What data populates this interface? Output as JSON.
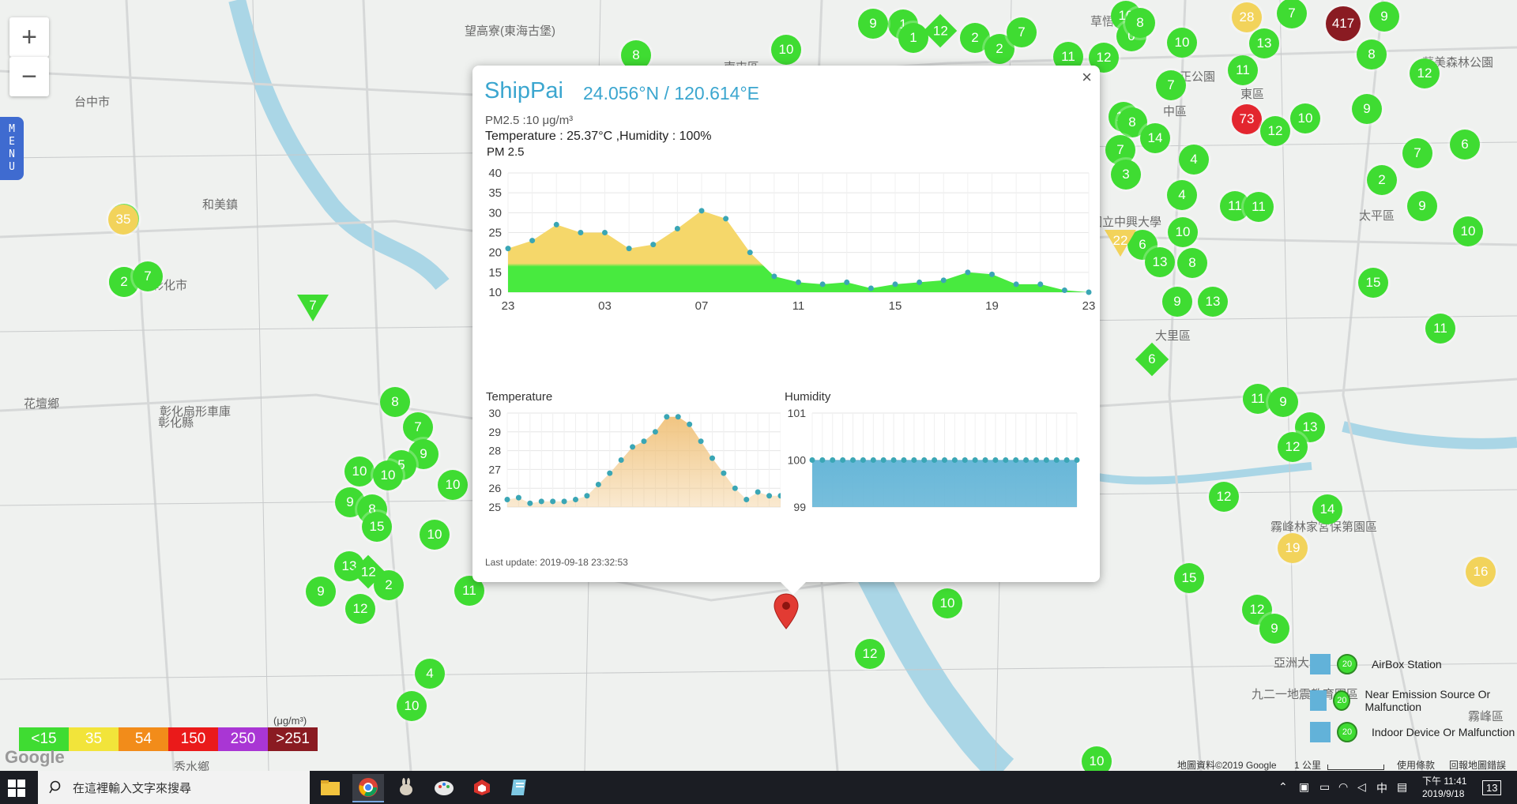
{
  "map": {
    "zoom_in": "+",
    "zoom_out": "−",
    "menu_letters": [
      "M",
      "E",
      "N",
      "U"
    ],
    "places": [
      {
        "name": "望高寮(東海古堡)"
      },
      {
        "name": "和美鎮"
      },
      {
        "name": "彰化市"
      },
      {
        "name": "中區"
      },
      {
        "name": "東區"
      },
      {
        "name": "大里區"
      },
      {
        "name": "太平區"
      },
      {
        "name": "霧峰林家宮保第園區"
      },
      {
        "name": "亞洲大學"
      },
      {
        "name": "九二一地震教育園區"
      },
      {
        "name": "霧峰區"
      },
      {
        "name": "秀水鄉"
      },
      {
        "name": "彰化縣"
      },
      {
        "name": "台中市"
      },
      {
        "name": "南屯區"
      },
      {
        "name": "國立中興大學"
      },
      {
        "name": "草悟道"
      },
      {
        "name": "中正公園"
      },
      {
        "name": "彰化扇形車庫"
      },
      {
        "name": "花壇鄉"
      },
      {
        "name": "華美森林公園"
      }
    ],
    "markers": [
      {
        "v": "8",
        "c": "g"
      },
      {
        "v": "10",
        "c": "g"
      },
      {
        "v": "1",
        "c": "g"
      },
      {
        "v": "9",
        "c": "g"
      },
      {
        "v": "1",
        "c": "g"
      },
      {
        "v": "10",
        "c": "g"
      },
      {
        "v": "0",
        "c": "g"
      },
      {
        "v": "10",
        "c": "g"
      },
      {
        "v": "28",
        "c": "y"
      },
      {
        "v": "7",
        "c": "g"
      },
      {
        "v": "417",
        "c": "m"
      },
      {
        "v": "9",
        "c": "g"
      },
      {
        "v": "2",
        "c": "g"
      },
      {
        "v": "2",
        "c": "g"
      },
      {
        "v": "7",
        "c": "g"
      },
      {
        "v": "11",
        "c": "g"
      },
      {
        "v": "12",
        "c": "g"
      },
      {
        "v": "10",
        "c": "g"
      },
      {
        "v": "13",
        "c": "g"
      },
      {
        "v": "12",
        "c": "g"
      },
      {
        "v": "8",
        "c": "g"
      },
      {
        "v": "11",
        "c": "g"
      },
      {
        "v": "7",
        "c": "g"
      },
      {
        "v": "9",
        "c": "g"
      },
      {
        "v": "73",
        "c": "r"
      },
      {
        "v": "12",
        "c": "g"
      },
      {
        "v": "10",
        "c": "g"
      },
      {
        "v": "8",
        "c": "g"
      },
      {
        "v": "14",
        "c": "g"
      },
      {
        "v": "7",
        "c": "g"
      },
      {
        "v": "6",
        "c": "g"
      },
      {
        "v": "7",
        "c": "g"
      },
      {
        "v": "4",
        "c": "g"
      },
      {
        "v": "3",
        "c": "g"
      },
      {
        "v": "4",
        "c": "g"
      },
      {
        "v": "2",
        "c": "g"
      },
      {
        "v": "9",
        "c": "g"
      },
      {
        "v": "10",
        "c": "g"
      },
      {
        "v": "11",
        "c": "g"
      },
      {
        "v": "11",
        "c": "g"
      },
      {
        "v": "10",
        "c": "g"
      },
      {
        "v": "6",
        "c": "g"
      },
      {
        "v": "13",
        "c": "g"
      },
      {
        "v": "8",
        "c": "g"
      },
      {
        "v": "15",
        "c": "g"
      },
      {
        "v": "9",
        "c": "g"
      },
      {
        "v": "13",
        "c": "g"
      },
      {
        "v": "11",
        "c": "g"
      },
      {
        "v": "11",
        "c": "g"
      },
      {
        "v": "9",
        "c": "g"
      },
      {
        "v": "13",
        "c": "g"
      },
      {
        "v": "12",
        "c": "g"
      },
      {
        "v": "12",
        "c": "g"
      },
      {
        "v": "14",
        "c": "g"
      },
      {
        "v": "19",
        "c": "y"
      },
      {
        "v": "16",
        "c": "y"
      },
      {
        "v": "15",
        "c": "g"
      },
      {
        "v": "12",
        "c": "g"
      },
      {
        "v": "9",
        "c": "g"
      },
      {
        "v": "10",
        "c": "g"
      },
      {
        "v": "12",
        "c": "g"
      },
      {
        "v": "10",
        "c": "g"
      },
      {
        "v": "10",
        "c": "g"
      },
      {
        "v": "13",
        "c": "g"
      },
      {
        "v": "35",
        "c": "y"
      },
      {
        "v": "2",
        "c": "g"
      },
      {
        "v": "7",
        "c": "g"
      },
      {
        "v": "8",
        "c": "g"
      },
      {
        "v": "7",
        "c": "g"
      },
      {
        "v": "9",
        "c": "g"
      },
      {
        "v": "10",
        "c": "g"
      },
      {
        "v": "5",
        "c": "g"
      },
      {
        "v": "10",
        "c": "g"
      },
      {
        "v": "10",
        "c": "g"
      },
      {
        "v": "9",
        "c": "g"
      },
      {
        "v": "8",
        "c": "g"
      },
      {
        "v": "15",
        "c": "g"
      },
      {
        "v": "10",
        "c": "g"
      },
      {
        "v": "13",
        "c": "g"
      },
      {
        "v": "2",
        "c": "g"
      },
      {
        "v": "9",
        "c": "g"
      },
      {
        "v": "12",
        "c": "g"
      },
      {
        "v": "11",
        "c": "g"
      },
      {
        "v": "4",
        "c": "g"
      },
      {
        "v": "10",
        "c": "g"
      },
      {
        "v": "8",
        "c": "g"
      }
    ],
    "diamonds": [
      {
        "v": "12"
      },
      {
        "v": "6"
      },
      {
        "v": "12"
      }
    ],
    "triangles": [
      {
        "v": "7",
        "c": "#3fdc32"
      },
      {
        "v": "22",
        "c": "#f2d35b"
      }
    ]
  },
  "popup": {
    "title": "ShipPai",
    "coord": "24.056°N / 120.614°E",
    "pm_line": "PM2.5 :10 μg/m³",
    "temp_line": "Temperature : 25.37°C ,Humidity : 100%",
    "chart_title": "PM 2.5",
    "temp_title": "Temperature",
    "hum_title": "Humidity",
    "last_update": "Last update: 2019-09-18 23:32:53",
    "close": "×"
  },
  "chart_data": [
    {
      "type": "area",
      "title": "PM 2.5",
      "x_ticks": [
        "23",
        "03",
        "07",
        "11",
        "15",
        "19",
        "23"
      ],
      "ylim": [
        10,
        40
      ],
      "y_ticks": [
        10,
        15,
        20,
        25,
        30,
        35,
        40
      ],
      "threshold": 20,
      "values": [
        21,
        23,
        27,
        25,
        25,
        21,
        22,
        26,
        30.5,
        28.5,
        20,
        14,
        12.5,
        12,
        12.5,
        11,
        12,
        12.5,
        13,
        15,
        14.5,
        12,
        12,
        10.5,
        10
      ],
      "colors": {
        "low": "#48ea3f",
        "high": "#f5d76a"
      }
    },
    {
      "type": "area",
      "title": "Temperature",
      "ylim": [
        25,
        30
      ],
      "y_ticks": [
        25,
        26,
        27,
        28,
        29,
        30
      ],
      "values": [
        25.4,
        25.5,
        25.2,
        25.3,
        25.3,
        25.3,
        25.4,
        25.6,
        26.2,
        26.8,
        27.5,
        28.2,
        28.5,
        29.0,
        29.8,
        29.8,
        29.4,
        28.5,
        27.6,
        26.8,
        26.0,
        25.4,
        25.8,
        25.6,
        25.6
      ],
      "color": "#f0c27b"
    },
    {
      "type": "area",
      "title": "Humidity",
      "ylim": [
        99,
        101
      ],
      "y_ticks": [
        99,
        100,
        101
      ],
      "values": [
        100,
        100,
        100,
        100,
        100,
        100,
        100,
        100,
        100,
        100,
        100,
        100,
        100,
        100,
        100,
        100,
        100,
        100,
        100,
        100,
        100,
        100,
        100,
        100,
        100,
        100,
        100
      ],
      "color": "#68b7d8"
    }
  ],
  "legend": {
    "items": [
      {
        "label": "<15",
        "color": "#3fdc32"
      },
      {
        "label": "35",
        "color": "#f2e43a"
      },
      {
        "label": "54",
        "color": "#f28c1a"
      },
      {
        "label": "150",
        "color": "#ea1a1a"
      },
      {
        "label": "250",
        "color": "#a936d4"
      },
      {
        "label": ">251",
        "color": "#8a1b22"
      }
    ],
    "unit": "(μg/m³)"
  },
  "key": {
    "rows": [
      {
        "label": "AirBox Station",
        "num": "20"
      },
      {
        "label": "Near Emission Source Or Malfunction",
        "num": "20"
      },
      {
        "label": "Indoor Device Or Malfunction",
        "num": "20"
      }
    ]
  },
  "attribution": {
    "google": "Google",
    "map_data": "地圖資料©2019 Google",
    "scale": "1 公里",
    "terms": "使用條款",
    "report": "回報地圖錯誤"
  },
  "taskbar": {
    "search_placeholder": "在這裡輸入文字來搜尋",
    "time": "下午 11:41",
    "date": "2019/9/18",
    "ime": "中",
    "notif": "13"
  }
}
